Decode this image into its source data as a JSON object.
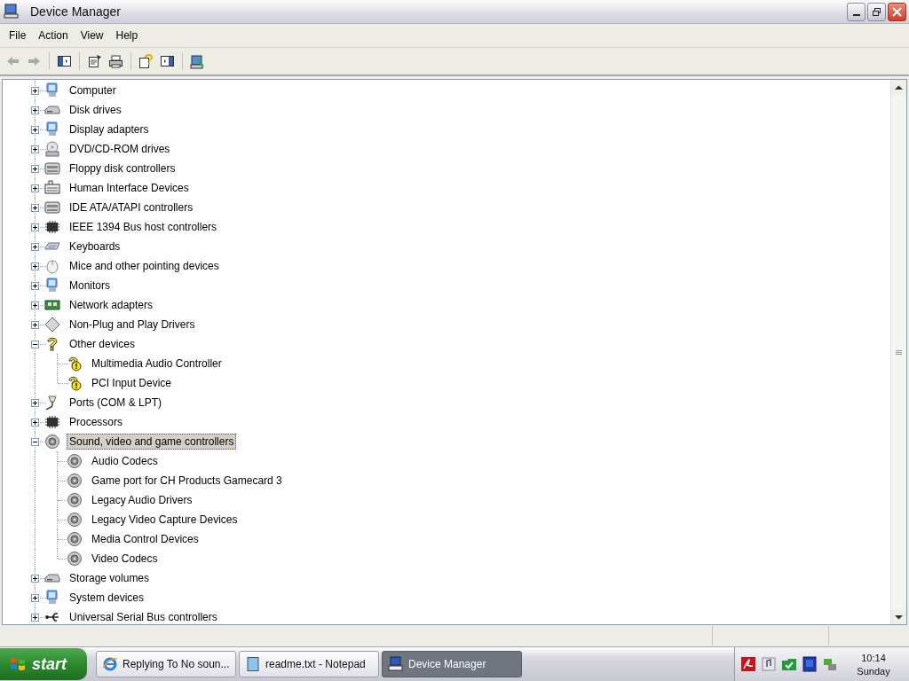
{
  "window": {
    "title": "Device Manager"
  },
  "menu": [
    "File",
    "Action",
    "View",
    "Help"
  ],
  "toolbar": [
    {
      "kind": "back",
      "disabled": true
    },
    {
      "kind": "forward",
      "disabled": true
    },
    {
      "kind": "sep"
    },
    {
      "kind": "tree"
    },
    {
      "kind": "sep"
    },
    {
      "kind": "properties"
    },
    {
      "kind": "print"
    },
    {
      "kind": "sep"
    },
    {
      "kind": "help"
    },
    {
      "kind": "pane"
    },
    {
      "kind": "sep"
    },
    {
      "kind": "scan"
    }
  ],
  "tree": [
    {
      "label": "Computer",
      "kind": "computer",
      "expanded": false,
      "selected": false
    },
    {
      "label": "Disk drives",
      "kind": "disk",
      "expanded": false,
      "selected": false
    },
    {
      "label": "Display adapters",
      "kind": "computer",
      "expanded": false,
      "selected": false
    },
    {
      "label": "DVD/CD-ROM drives",
      "kind": "disc",
      "expanded": false,
      "selected": false
    },
    {
      "label": "Floppy disk controllers",
      "kind": "controller",
      "expanded": false,
      "selected": false
    },
    {
      "label": "Human Interface Devices",
      "kind": "hid",
      "expanded": false,
      "selected": false
    },
    {
      "label": "IDE ATA/ATAPI controllers",
      "kind": "controller",
      "expanded": false,
      "selected": false
    },
    {
      "label": "IEEE 1394 Bus host controllers",
      "kind": "chip",
      "expanded": false,
      "selected": false
    },
    {
      "label": "Keyboards",
      "kind": "keyboard",
      "expanded": false,
      "selected": false
    },
    {
      "label": "Mice and other pointing devices",
      "kind": "mouse",
      "expanded": false,
      "selected": false
    },
    {
      "label": "Monitors",
      "kind": "computer",
      "expanded": false,
      "selected": false
    },
    {
      "label": "Network adapters",
      "kind": "network",
      "expanded": false,
      "selected": false
    },
    {
      "label": "Non-Plug and Play Drivers",
      "kind": "diamond",
      "expanded": false,
      "selected": false
    },
    {
      "label": "Other devices",
      "kind": "unknown",
      "expanded": true,
      "selected": false,
      "children": [
        {
          "label": "Multimedia Audio Controller",
          "kind": "warning",
          "selected": false
        },
        {
          "label": "PCI Input Device",
          "kind": "warning",
          "selected": false
        }
      ]
    },
    {
      "label": "Ports (COM & LPT)",
      "kind": "port",
      "expanded": false,
      "selected": false
    },
    {
      "label": "Processors",
      "kind": "chip",
      "expanded": false,
      "selected": false
    },
    {
      "label": "Sound, video and game controllers",
      "kind": "speaker",
      "expanded": true,
      "selected": true,
      "children": [
        {
          "label": "Audio Codecs",
          "kind": "speaker",
          "selected": false
        },
        {
          "label": "Game port for CH Products Gamecard 3",
          "kind": "speaker",
          "selected": false
        },
        {
          "label": "Legacy Audio Drivers",
          "kind": "speaker",
          "selected": false
        },
        {
          "label": "Legacy Video Capture Devices",
          "kind": "speaker",
          "selected": false
        },
        {
          "label": "Media Control Devices",
          "kind": "speaker",
          "selected": false
        },
        {
          "label": "Video Codecs",
          "kind": "speaker",
          "selected": false
        }
      ]
    },
    {
      "label": "Storage volumes",
      "kind": "disk",
      "expanded": false,
      "selected": false
    },
    {
      "label": "System devices",
      "kind": "computer",
      "expanded": false,
      "selected": false
    },
    {
      "label": "Universal Serial Bus controllers",
      "kind": "usb",
      "expanded": false,
      "selected": false
    }
  ],
  "taskbar": {
    "start": "start",
    "tasks": [
      {
        "title": "Replying To No soun...",
        "kind": "browser",
        "selected": false
      },
      {
        "title": "readme.txt - Notepad",
        "kind": "notepad",
        "selected": false
      },
      {
        "title": "Device Manager",
        "kind": "computer",
        "selected": true
      }
    ],
    "tray": [
      {
        "kind": "pdf"
      },
      {
        "kind": "note"
      },
      {
        "kind": "check"
      },
      {
        "kind": "book"
      },
      {
        "kind": "network"
      }
    ],
    "clock": {
      "time": "10:14",
      "day": "Sunday"
    }
  }
}
